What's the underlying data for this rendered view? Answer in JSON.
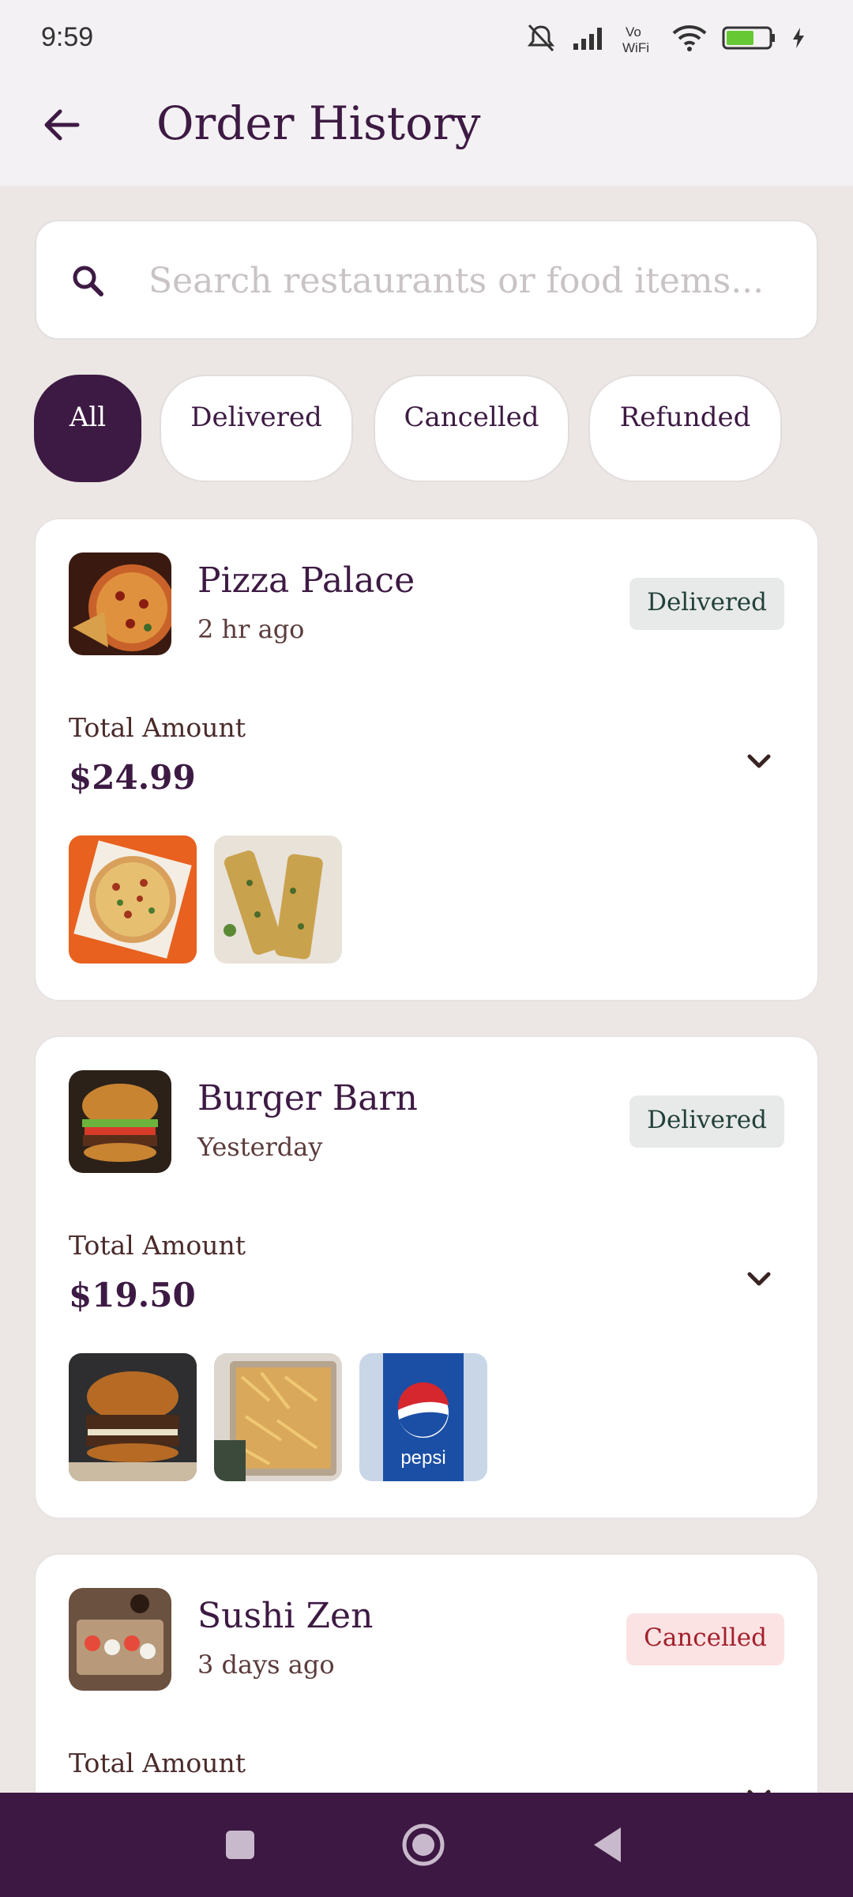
{
  "status": {
    "time": "9:59",
    "battery": "61"
  },
  "header": {
    "title": "Order History"
  },
  "search": {
    "placeholder": "Search restaurants or food items..."
  },
  "filters": [
    "All",
    "Delivered",
    "Cancelled",
    "Refunded"
  ],
  "orders": [
    {
      "restaurant": "Pizza Palace",
      "time": "2 hr ago",
      "status": "Delivered",
      "total_label": "Total Amount",
      "total": "$24.99",
      "items": [
        "pizza",
        "garlic-bread"
      ]
    },
    {
      "restaurant": "Burger Barn",
      "time": "Yesterday",
      "status": "Delivered",
      "total_label": "Total Amount",
      "total": "$19.50",
      "items": [
        "burger",
        "fries",
        "pepsi"
      ]
    },
    {
      "restaurant": "Sushi Zen",
      "time": "3 days ago",
      "status": "Cancelled",
      "total_label": "Total Amount",
      "total": "",
      "items": []
    }
  ],
  "colors": {
    "primary": "#3d1a43",
    "background": "#ece7e5",
    "cancelled": "#a3202b"
  }
}
